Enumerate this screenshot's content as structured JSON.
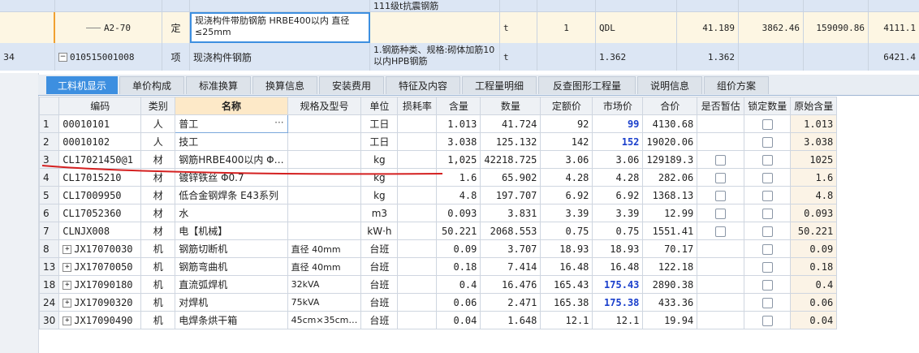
{
  "top_rows": [
    {
      "id": "partial",
      "num": "",
      "code": "",
      "type": "",
      "name": "",
      "spec": "111级t抗震钢筋",
      "unit": "",
      "qty_expr": "",
      "qty_main": "",
      "qty": "",
      "price": "",
      "total": "",
      "extra": ""
    },
    {
      "id": "a2-70",
      "num": "",
      "code": "A2-70",
      "type": "定",
      "name": "现浇构件带肋钢筋 HRBE400以内 直径≤25mm",
      "spec": "",
      "unit": "t",
      "qty_expr": "1",
      "qty_main": "QDL",
      "qty": "41.189",
      "price": "3862.46",
      "total": "159090.86",
      "extra": "4111.1"
    },
    {
      "id": "010515001008",
      "num": "34",
      "code": "010515001008",
      "type": "项",
      "name": "现浇构件钢筋",
      "spec": "1.钢筋种类、规格:砌体加筋10以内HPB钢筋",
      "unit": "t",
      "qty_expr": "",
      "qty_main": "1.362",
      "qty": "1.362",
      "price": "",
      "total": "",
      "extra": "6421.4"
    }
  ],
  "tabs": [
    "工料机显示",
    "单价构成",
    "标准换算",
    "换算信息",
    "安装费用",
    "特征及内容",
    "工程量明细",
    "反查图形工程量",
    "说明信息",
    "组价方案"
  ],
  "columns": [
    "编码",
    "类别",
    "名称",
    "规格及型号",
    "单位",
    "损耗率",
    "含量",
    "数量",
    "定额价",
    "市场价",
    "合价",
    "是否暂估",
    "锁定数量",
    "原始含量"
  ],
  "rows": [
    {
      "rn": "1",
      "code": "00010101",
      "cat": "人",
      "name": "普工",
      "spec": "",
      "unit": "工日",
      "loss": "",
      "content": "1.013",
      "qty": "41.724",
      "quota": "92",
      "market": "99",
      "market_blue": true,
      "total": "4130.68",
      "est": false,
      "lock": true,
      "orig": "1.013",
      "expand": false
    },
    {
      "rn": "2",
      "code": "00010102",
      "cat": "人",
      "name": "技工",
      "spec": "",
      "unit": "工日",
      "loss": "",
      "content": "3.038",
      "qty": "125.132",
      "quota": "142",
      "market": "152",
      "market_blue": true,
      "total": "19020.06",
      "est": false,
      "lock": true,
      "orig": "3.038",
      "expand": false
    },
    {
      "rn": "3",
      "code": "CL17021450@1",
      "cat": "材",
      "name": "钢筋HRBE400以内 Φ…",
      "spec": "",
      "unit": "kg",
      "loss": "",
      "content": "1,025",
      "qty": "42218.725",
      "quota": "3.06",
      "market": "3.06",
      "market_blue": false,
      "total": "129189.3",
      "est": true,
      "lock": true,
      "orig": "1025",
      "expand": false
    },
    {
      "rn": "4",
      "code": "CL17015210",
      "cat": "材",
      "name": "镀锌铁丝 Φ0.7",
      "spec": "",
      "unit": "kg",
      "loss": "",
      "content": "1.6",
      "qty": "65.902",
      "quota": "4.28",
      "market": "4.28",
      "market_blue": false,
      "total": "282.06",
      "est": true,
      "lock": true,
      "orig": "1.6",
      "expand": false
    },
    {
      "rn": "5",
      "code": "CL17009950",
      "cat": "材",
      "name": "低合金钢焊条 E43系列",
      "spec": "",
      "unit": "kg",
      "loss": "",
      "content": "4.8",
      "qty": "197.707",
      "quota": "6.92",
      "market": "6.92",
      "market_blue": false,
      "total": "1368.13",
      "est": true,
      "lock": true,
      "orig": "4.8",
      "expand": false
    },
    {
      "rn": "6",
      "code": "CL17052360",
      "cat": "材",
      "name": "水",
      "spec": "",
      "unit": "m3",
      "loss": "",
      "content": "0.093",
      "qty": "3.831",
      "quota": "3.39",
      "market": "3.39",
      "market_blue": false,
      "total": "12.99",
      "est": true,
      "lock": true,
      "orig": "0.093",
      "expand": false
    },
    {
      "rn": "7",
      "code": "CLNJX008",
      "cat": "材",
      "name": "电【机械】",
      "spec": "",
      "unit": "kW·h",
      "loss": "",
      "content": "50.221",
      "qty": "2068.553",
      "quota": "0.75",
      "market": "0.75",
      "market_blue": false,
      "total": "1551.41",
      "est": true,
      "lock": true,
      "orig": "50.221",
      "expand": false
    },
    {
      "rn": "8",
      "code": "JX17070030",
      "cat": "机",
      "name": "钢筋切断机",
      "spec": "直径 40mm",
      "unit": "台班",
      "loss": "",
      "content": "0.09",
      "qty": "3.707",
      "quota": "18.93",
      "market": "18.93",
      "market_blue": false,
      "total": "70.17",
      "est": false,
      "lock": true,
      "orig": "0.09",
      "expand": true
    },
    {
      "rn": "13",
      "code": "JX17070050",
      "cat": "机",
      "name": "钢筋弯曲机",
      "spec": "直径 40mm",
      "unit": "台班",
      "loss": "",
      "content": "0.18",
      "qty": "7.414",
      "quota": "16.48",
      "market": "16.48",
      "market_blue": false,
      "total": "122.18",
      "est": false,
      "lock": true,
      "orig": "0.18",
      "expand": true
    },
    {
      "rn": "18",
      "code": "JX17090180",
      "cat": "机",
      "name": "直流弧焊机",
      "spec": "32kVA",
      "unit": "台班",
      "loss": "",
      "content": "0.4",
      "qty": "16.476",
      "quota": "165.43",
      "market": "175.43",
      "market_blue": true,
      "total": "2890.38",
      "est": false,
      "lock": true,
      "orig": "0.4",
      "expand": true
    },
    {
      "rn": "24",
      "code": "JX17090320",
      "cat": "机",
      "name": "对焊机",
      "spec": "75kVA",
      "unit": "台班",
      "loss": "",
      "content": "0.06",
      "qty": "2.471",
      "quota": "165.38",
      "market": "175.38",
      "market_blue": true,
      "total": "433.36",
      "est": false,
      "lock": true,
      "orig": "0.06",
      "expand": true
    },
    {
      "rn": "30",
      "code": "JX17090490",
      "cat": "机",
      "name": "电焊条烘干箱",
      "spec": "45cm×35cm…",
      "unit": "台班",
      "loss": "",
      "content": "0.04",
      "qty": "1.648",
      "quota": "12.1",
      "market": "12.1",
      "market_blue": false,
      "total": "19.94",
      "est": false,
      "lock": true,
      "orig": "0.04",
      "expand": true
    }
  ],
  "colors": {
    "active_tab": "#3d8fe0",
    "blue_price": "#1a3fcc",
    "annotation": "#d42020",
    "selected_row": "#fdf6e3",
    "header_highlight": "#fde9c8"
  }
}
